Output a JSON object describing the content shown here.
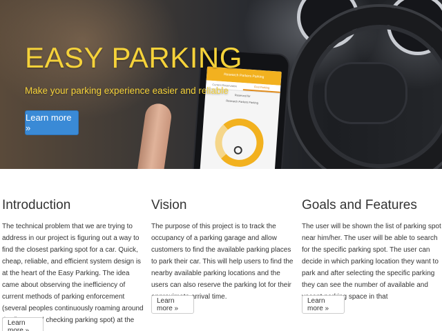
{
  "hero": {
    "title": "EASY PARKING",
    "subtitle": "Make your parking experience easier and reliable",
    "button_label": "Learn more »",
    "phone_app_title": "Research Parkers Parking",
    "phone_tab_1": "Current Reservation",
    "phone_tab_2": "Find Parking",
    "phone_subtitle_1": "Reserved for",
    "phone_subtitle_2": "Research Parkers Parking"
  },
  "columns": [
    {
      "heading": "Introduction",
      "body": "The technical problem that we are trying to address in our project is figuring out a way to find the closest parking spot for a car. Quick, cheap, reliable, and efficient system design is at the heart of the Easy Parking. The idea came about observing the inefficiency of current methods of parking enforcement (several peoples continuously roaming around the floors and checking parking spot) at the campus area.",
      "button_label": "Learn more »"
    },
    {
      "heading": "Vision",
      "body": "The purpose of this project is to track the occupancy of a parking garage and allow customers to find the available parking places to park their car. This will help users to find the nearby available parking locations and the users can also reserve the parking lot for their approximate arrival time.",
      "button_label": "Learn more »"
    },
    {
      "heading": "Goals and Features",
      "body": "The user will be shown the list of parking spot near him/her. The user will be able to search for the specific parking spot. The user can decide in which parking location they want to park and after selecting the specific parking they can see the number of available and vacant parking space in that",
      "button_label": "Learn more »"
    }
  ],
  "colors": {
    "accent_yellow": "#f5d23a",
    "primary_button": "#3a8ad6"
  }
}
